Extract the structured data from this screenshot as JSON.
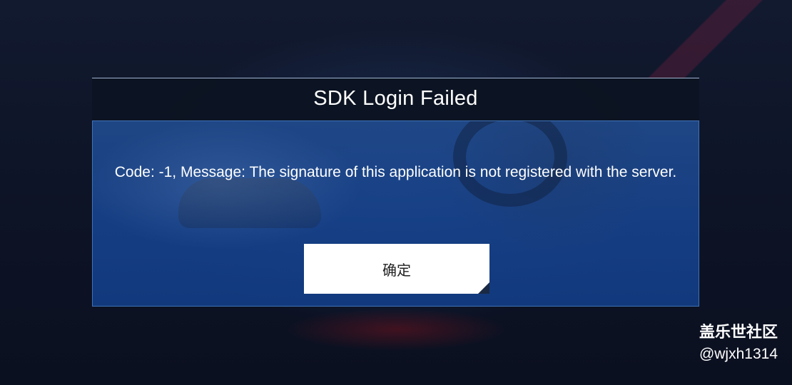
{
  "dialog": {
    "title": "SDK Login Failed",
    "message": "Code: -1, Message: The signature of this application is not registered with the server.",
    "confirm_label": "确定"
  },
  "watermark": {
    "brand": "盖乐世社区",
    "user": "@wjxh1314"
  }
}
